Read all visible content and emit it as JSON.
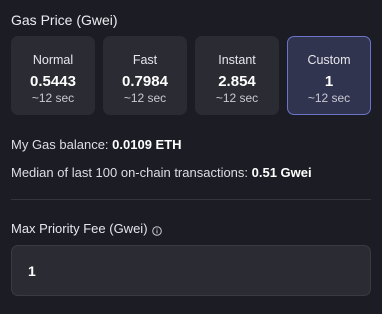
{
  "gas": {
    "title": "Gas Price (Gwei)",
    "options": [
      {
        "label": "Normal",
        "price": "0.5443",
        "time": "~12 sec"
      },
      {
        "label": "Fast",
        "price": "0.7984",
        "time": "~12 sec"
      },
      {
        "label": "Instant",
        "price": "2.854",
        "time": "~12 sec"
      },
      {
        "label": "Custom",
        "price": "1",
        "time": "~12 sec"
      }
    ],
    "selected": "Custom"
  },
  "balance": {
    "label": "My Gas balance: ",
    "value": "0.0109 ETH"
  },
  "median": {
    "label": "Median of last 100 on-chain transactions: ",
    "value": "0.51 Gwei"
  },
  "priority_fee": {
    "label": "Max Priority Fee (Gwei)",
    "value": "1",
    "icon": "info-icon"
  },
  "colors": {
    "background": "#1c1c24",
    "card": "#2b2b33",
    "selected_card": "#30344f",
    "selected_border": "#6b74c9"
  }
}
